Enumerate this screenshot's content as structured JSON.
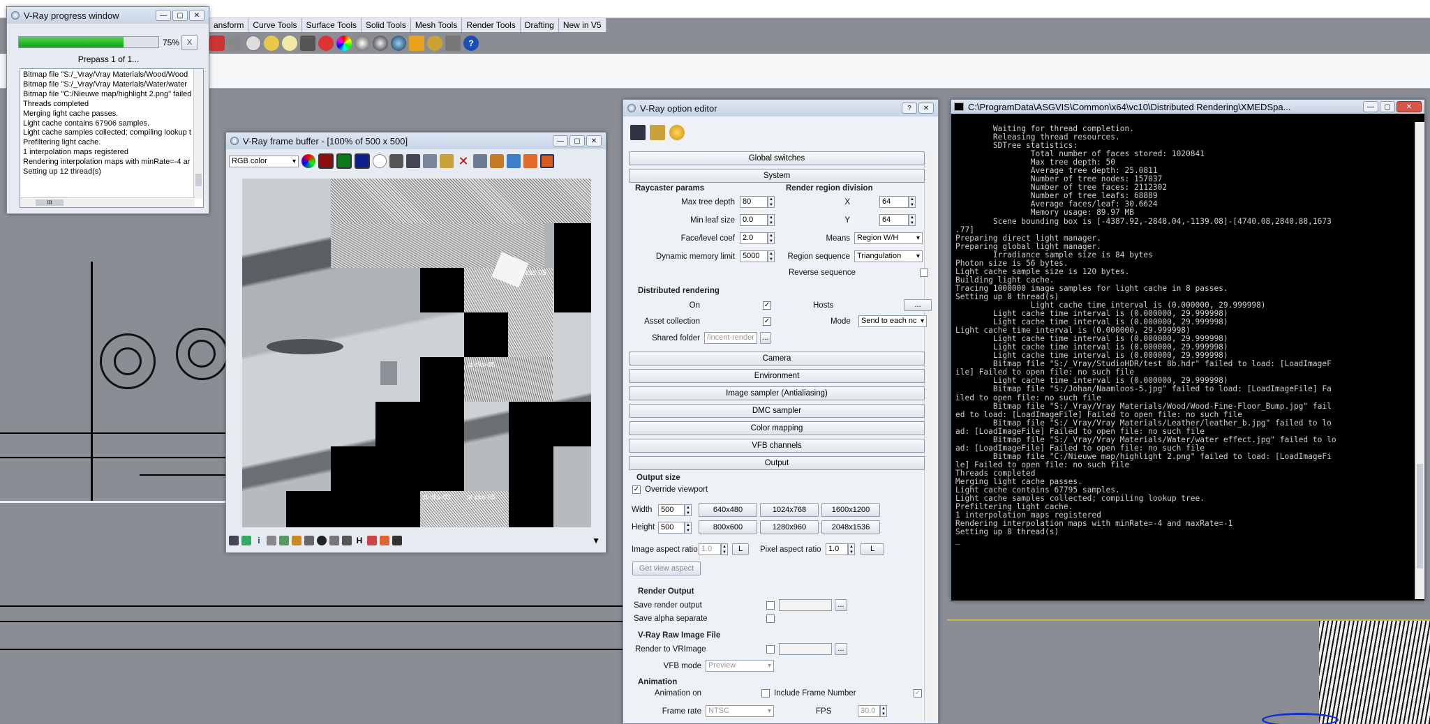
{
  "rhino": {
    "tabs": [
      "ansform",
      "Curve Tools",
      "Surface Tools",
      "Solid Tools",
      "Mesh Tools",
      "Render Tools",
      "Drafting",
      "New in V5"
    ]
  },
  "progress": {
    "title": "V-Ray progress window",
    "percent": "75%",
    "progress_fraction": 0.75,
    "cancel": "X",
    "pass": "Prepass 1 of 1...",
    "log": [
      "Bitmap file \"S:/_Vray/Vray Materials/Wood/Wood",
      "Bitmap file \"S:/_Vray/Vray Materials/Water/water",
      "Bitmap file \"C:/Nieuwe map/highlight 2.png\" failed",
      "Threads completed",
      "Merging light cache passes.",
      "Light cache contains 67906 samples.",
      "Light cache samples collected; compiling lookup tr",
      "Prefiltering light cache.",
      "1 interpolation maps registered",
      "Rendering interpolation maps with minRate=-4 ar",
      "Setting up 12 thread(s)"
    ],
    "hscroll": "III"
  },
  "vfb": {
    "title": "V-Ray frame buffer - [100% of 500 x 500]",
    "channel": "RGB color",
    "tile_labels": [
      "st-cks-05",
      "st-cks-05",
      "st-cks-03",
      "st-cks-05"
    ]
  },
  "option_editor": {
    "title": "V-Ray option editor",
    "help": "?",
    "rollouts_top": [
      "Global switches",
      "System"
    ],
    "raycaster": {
      "heading": "Raycaster params",
      "rows": [
        {
          "label": "Max tree depth",
          "value": "80"
        },
        {
          "label": "Min leaf size",
          "value": "0.0"
        },
        {
          "label": "Face/level coef",
          "value": "2.0"
        },
        {
          "label": "Dynamic memory limit",
          "value": "5000"
        }
      ]
    },
    "region": {
      "heading": "Render region division",
      "x_label": "X",
      "x": "64",
      "y_label": "Y",
      "y": "64",
      "means_label": "Means",
      "means": "Region W/H",
      "seq_label": "Region sequence",
      "seq": "Triangulation",
      "reverse_label": "Reverse sequence"
    },
    "dr": {
      "heading": "Distributed rendering",
      "on_label": "On",
      "hosts_label": "Hosts",
      "hosts_btn": "...",
      "asset_label": "Asset collection",
      "mode_label": "Mode",
      "mode": "Send to each nc",
      "shared_label": "Shared folder",
      "shared": "/incent-render",
      "shared_btn": "..."
    },
    "rollouts_mid": [
      "Camera",
      "Environment",
      "Image sampler (Antialiasing)",
      "DMC sampler",
      "Color mapping",
      "VFB channels",
      "Output"
    ],
    "output": {
      "heading": "Output size",
      "override": "Override viewport",
      "width_label": "Width",
      "width": "500",
      "height_label": "Height",
      "height": "500",
      "presets": [
        "640x480",
        "1024x768",
        "1600x1200",
        "800x600",
        "1280x960",
        "2048x1536"
      ],
      "aspect_label": "Image aspect ratio",
      "aspect": "1.0",
      "lock": "L",
      "pixel_label": "Pixel aspect ratio",
      "pixel": "1.0",
      "pixel_lock": "L",
      "get_view": "Get view aspect"
    },
    "render_output": {
      "heading": "Render Output",
      "save": "Save render output",
      "save_btn": "...",
      "alpha": "Save alpha separate"
    },
    "raw": {
      "heading": "V-Ray Raw Image File",
      "render_label": "Render to VRImage",
      "raw_btn": "...",
      "mode_label": "VFB mode",
      "mode": "Preview"
    },
    "animation": {
      "heading": "Animation",
      "on_label": "Animation on",
      "frame_label": "Include Frame Number",
      "rate_label": "Frame rate",
      "rate": "NTSC",
      "fps_label": "FPS",
      "fps": "30.0"
    }
  },
  "console": {
    "title": "C:\\ProgramData\\ASGVIS\\Common\\x64\\vc10\\Distributed Rendering\\XMEDSpa...",
    "text": "        Waiting for thread completion.\n        Releasing thread resources.\n        SDTree statistics:\n                Total number of faces stored: 1020841\n                Max tree depth: 50\n                Average tree depth: 25.0811\n                Number of tree nodes: 157037\n                Number of tree faces: 2112302\n                Number of tree leafs: 68889\n                Average faces/leaf: 30.6624\n                Memory usage: 89.97 MB\n        Scene bounding box is [-4387.92,-2848.04,-1139.08]-[4740.08,2840.88,1673\n.77]\nPreparing direct light manager.\nPreparing global light manager.\n        Irradiance sample size is 84 bytes\nPhoton size is 56 bytes.\nLight cache sample size is 120 bytes.\nBuilding light cache.\nTracing 1000000 image samples for light cache in 8 passes.\nSetting up 8 thread(s)\n                Light cache time interval is (0.000000, 29.999998)\n        Light cache time interval is (0.000000, 29.999998)\n        Light cache time interval is (0.000000, 29.999998)\nLight cache time interval is (0.000000, 29.999998)\n        Light cache time interval is (0.000000, 29.999998)\n        Light cache time interval is (0.000000, 29.999998)\n        Light cache time interval is (0.000000, 29.999998)\n        Bitmap file \"S:/_Vray/StudioHDR/test 8b.hdr\" failed to load: [LoadImageF\nile] Failed to open file: no such file\n        Light cache time interval is (0.000000, 29.999998)\n        Bitmap file \"S:/Johan/Naamloos-5.jpg\" failed to load: [LoadImageFile] Fa\niled to open file: no such file\n        Bitmap file \"S:/_Vray/Vray Materials/Wood/Wood-Fine-Floor_Bump.jpg\" fail\ned to load: [LoadImageFile] Failed to open file: no such file\n        Bitmap file \"S:/_Vray/Vray Materials/Leather/leather_b.jpg\" failed to lo\nad: [LoadImageFile] Failed to open file: no such file\n        Bitmap file \"S:/_Vray/Vray Materials/Water/water effect.jpg\" failed to lo\nad: [LoadImageFile] Failed to open file: no such file\n        Bitmap file \"C:/Nieuwe map/highlight 2.png\" failed to load: [LoadImageFi\nle] Failed to open file: no such file\nThreads completed\nMerging light cache passes.\nLight cache contains 67795 samples.\nLight cache samples collected; compiling lookup tree.\nPrefiltering light cache.\n1 interpolation maps registered\nRendering interpolation maps with minRate=-4 and maxRate=-1\nSetting up 8 thread(s)\n_"
  }
}
